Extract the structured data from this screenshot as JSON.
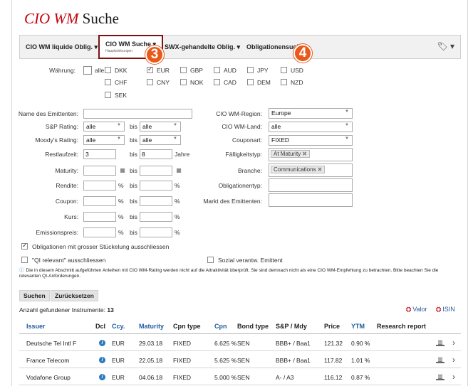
{
  "title": {
    "brand": "CIO WM",
    "word": "Suche"
  },
  "nav": {
    "tabs": [
      {
        "label": "CIO WM liquide Oblig. ▾"
      },
      {
        "label": "CIO WM Suche ▾",
        "sub": "Hauptwährungen"
      },
      {
        "label": "SWX-gehandelte Oblig. ▾"
      },
      {
        "label": "Obligationensuche"
      }
    ],
    "tools_icon": "tag-icon"
  },
  "annotations": {
    "a3": "3",
    "a4": "4"
  },
  "currency": {
    "label": "Währung:",
    "all": "alle",
    "options": [
      "DKK",
      "EUR",
      "GBP",
      "AUD",
      "JPY",
      "USD",
      "CHF",
      "CNY",
      "NOK",
      "CAD",
      "DEM",
      "NZD",
      "SEK"
    ],
    "checked": [
      "EUR"
    ]
  },
  "form": {
    "issuer_label": "Name des Emittenten:",
    "issuer_value": "",
    "sp_label": "S&P Rating:",
    "sp_from": "alle",
    "sp_to": "alle",
    "moodys_label": "Moody's Rating:",
    "moodys_from": "alle",
    "moodys_to": "alle",
    "bis": "bis",
    "rest_label": "Restlaufzeit:",
    "rest_from": "3",
    "rest_to": "8",
    "rest_unit": "Jahre",
    "maturity_label": "Maturity:",
    "rendite_label": "Rendite:",
    "coupon_label": "Coupon:",
    "kurs_label": "Kurs:",
    "emission_label": "Emissionspreis:",
    "pct": "%",
    "region_label": "CIO WM-Region:",
    "region_value": "Europe",
    "land_label": "CIO WM-Land:",
    "land_value": "alle",
    "couponart_label": "Couponart:",
    "couponart_value": "FIXED",
    "faellig_label": "Fälligkeitstyp:",
    "faellig_tag": "At Maturity",
    "branche_label": "Branche:",
    "branche_tag": "Communications",
    "obltyp_label": "Obligationentyp:",
    "markt_label": "Markt des Emittenten:"
  },
  "options": {
    "exclude_large": "Obligationen mit grosser Stückelung ausschliessen",
    "exclude_qi": "\"QI relevant\" ausschliessen",
    "social": "Sozial verantw. Emittent"
  },
  "info_text": "Die in diesem Abschnitt aufgeführten Anleihen mit CIO WM-Rating werden nicht auf die Attraktivität überprüft. Sie sind demnach nicht als eine CIO WM-Empfehlung zu betrachten. Bitte beachten Sie die relevanten QI-Anforderungen.",
  "buttons": {
    "search": "Suchen",
    "reset": "Zurücksetzen"
  },
  "results": {
    "count_label": "Anzahl gefundener Instrumente:",
    "count": "13",
    "export_valor": "Valor",
    "export_isin": "ISIN"
  },
  "table": {
    "headers": [
      "Issuer",
      "Dcl",
      "Ccy.",
      "Maturity",
      "Cpn type",
      "Cpn",
      "Bond type",
      "S&P / Mdy",
      "Price",
      "YTM",
      "Research report"
    ],
    "rows": [
      {
        "issuer": "Deutsche Tel Intl F",
        "ccy": "EUR",
        "maturity": "29.03.18",
        "cpn_type": "FIXED",
        "cpn": "6.625 %",
        "bond_type": "SEN",
        "rating": "BBB+ / Baa1",
        "price": "121.32",
        "ytm": "0.90 %"
      },
      {
        "issuer": "France Telecom",
        "ccy": "EUR",
        "maturity": "22.05.18",
        "cpn_type": "FIXED",
        "cpn": "5.625 %",
        "bond_type": "SEN",
        "rating": "BBB+ / Baa1",
        "price": "117.82",
        "ytm": "1.01 %"
      },
      {
        "issuer": "Vodafone Group",
        "ccy": "EUR",
        "maturity": "04.06.18",
        "cpn_type": "FIXED",
        "cpn": "5.000 %",
        "bond_type": "SEN",
        "rating": "A- / A3",
        "price": "116.12",
        "ytm": "0.87 %"
      }
    ]
  },
  "colors": {
    "brand": "#c2000b",
    "link": "#1f5c9e",
    "annotation": "#e8591a",
    "active_border": "#7a1212"
  }
}
